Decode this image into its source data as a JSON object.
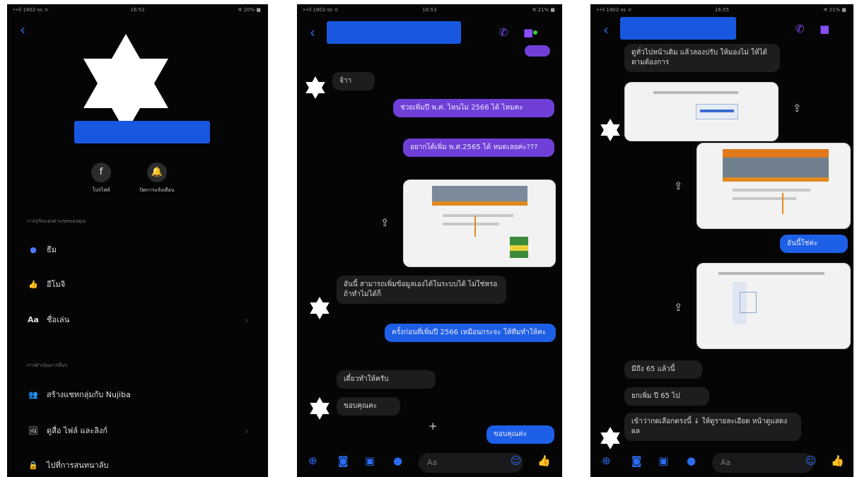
{
  "screen1": {
    "status_left": "••ll 1802-ss ᯤ",
    "status_center": "16:52",
    "status_right": "✲ 20% ■",
    "back": "‹",
    "profile_btn_label": "โปรไฟล์",
    "mute_btn_label": "ปิดการแจ้งเตือน",
    "section_custom": "การปรับแต่งค่าแชทของคุณ",
    "items": [
      {
        "icon": "●",
        "label": "ธีม"
      },
      {
        "icon": "👍",
        "label": "อีโมจิ"
      },
      {
        "icon": "Aa",
        "label": "ชื่อเล่น"
      }
    ],
    "section_more": "การดำเนินการอื่นๆ",
    "more_items": [
      {
        "icon": "👥",
        "label": "สร้างแชทกลุ่มกับ Nujiba"
      },
      {
        "icon": "🖼",
        "label": "ดูสื่อ ไฟล์ และลิงก์"
      },
      {
        "icon": "🔒",
        "label": "ไปที่การสนทนาลับ"
      }
    ]
  },
  "screen2": {
    "status_left": "••ll 1802-ss ᯤ",
    "status_center": "16:53",
    "status_right": "✲ 21% ■",
    "back": "‹",
    "messages": {
      "m1": "จ้าา",
      "m2": "ช่วยเพิ่มปี พ.ศ. ไหนไม่ 2566 ได้ ไหมคะ",
      "m3": "อยากได้เพิ่ม พ.ศ.2565 ได้ หมดเลยค่ะ???",
      "m4": "อันนี้ สามารถเพิ่มข้อมูลเองได้ในระบบได้ ไม่ใช่หรอ ถ้าทำไม่ได้ก็",
      "m5": "ครั้งก่อนที่เพิ่มปี 2566 เหมือนกระจะ ให้ทีมทำให้คะ",
      "m6": "เดี๋ยวทำให้ครับ",
      "m7": "ขอบคุณคะ",
      "m8": "ขอบคุณค่ะ"
    },
    "composer": "Aa"
  },
  "screen3": {
    "status_left": "••ll 1802-ss ᯤ",
    "status_center": "16:55",
    "status_right": "✲ 21% ■",
    "back": "‹",
    "messages": {
      "m1": "ดูทั่วไปหน้าเดิม แล้วลองปรับ ให้มองไม่ ให้ได้ตามต้องการ",
      "m2": "อันนี้ใช่ค่ะ",
      "m3": "มีถึง 65 แล้วนี้",
      "m4": "ยกเพิ่ม ปี 65 ไป",
      "m5": "เข้าว่ากดเลือกตรงนี้ ↓ ให้ดูรายละเอียด หน้าดูแสดงผล"
    },
    "composer": "Aa"
  }
}
